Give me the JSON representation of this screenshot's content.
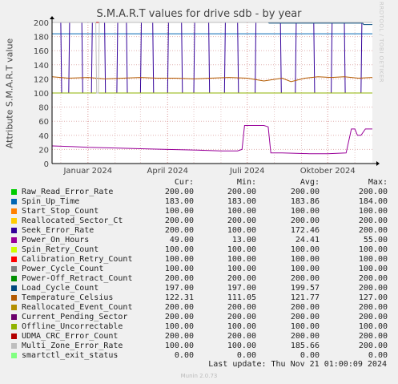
{
  "title": "S.M.A.R.T values for drive sdb - by year",
  "watermark": "RRDTOOL / TOBI OETIKER",
  "last_update": "Last update: Thu Nov 21 01:00:09 2024",
  "footer": "Munin 2.0.73",
  "legend_headers": {
    "cur": "Cur:",
    "min": "Min:",
    "avg": "Avg:",
    "max": "Max:"
  },
  "legend": [
    {
      "name": "Raw_Read_Error_Rate",
      "color": "#00cc00",
      "cur": "200.00",
      "min": "200.00",
      "avg": "200.00",
      "max": "200.00"
    },
    {
      "name": "Spin_Up_Time",
      "color": "#0066b3",
      "cur": "183.00",
      "min": "183.00",
      "avg": "183.86",
      "max": "184.00"
    },
    {
      "name": "Start_Stop_Count",
      "color": "#ff8000",
      "cur": "100.00",
      "min": "100.00",
      "avg": "100.00",
      "max": "100.00"
    },
    {
      "name": "Reallocated_Sector_Ct",
      "color": "#ffcc00",
      "cur": "200.00",
      "min": "200.00",
      "avg": "200.00",
      "max": "200.00"
    },
    {
      "name": "Seek_Error_Rate",
      "color": "#330099",
      "cur": "200.00",
      "min": "100.00",
      "avg": "172.46",
      "max": "200.00"
    },
    {
      "name": "Power_On_Hours",
      "color": "#990099",
      "cur": "49.00",
      "min": "13.00",
      "avg": "24.41",
      "max": "55.00"
    },
    {
      "name": "Spin_Retry_Count",
      "color": "#ccff00",
      "cur": "100.00",
      "min": "100.00",
      "avg": "100.00",
      "max": "100.00"
    },
    {
      "name": "Calibration_Retry_Count",
      "color": "#ff0000",
      "cur": "100.00",
      "min": "100.00",
      "avg": "100.00",
      "max": "100.00"
    },
    {
      "name": "Power_Cycle_Count",
      "color": "#808080",
      "cur": "100.00",
      "min": "100.00",
      "avg": "100.00",
      "max": "100.00"
    },
    {
      "name": "Power-Off_Retract_Count",
      "color": "#008f00",
      "cur": "200.00",
      "min": "200.00",
      "avg": "200.00",
      "max": "200.00"
    },
    {
      "name": "Load_Cycle_Count",
      "color": "#00487d",
      "cur": "197.00",
      "min": "197.00",
      "avg": "199.57",
      "max": "200.00"
    },
    {
      "name": "Temperature_Celsius",
      "color": "#b35a00",
      "cur": "122.31",
      "min": "111.05",
      "avg": "121.77",
      "max": "127.00"
    },
    {
      "name": "Reallocated_Event_Count",
      "color": "#b38f00",
      "cur": "200.00",
      "min": "200.00",
      "avg": "200.00",
      "max": "200.00"
    },
    {
      "name": "Current_Pending_Sector",
      "color": "#6b006b",
      "cur": "200.00",
      "min": "200.00",
      "avg": "200.00",
      "max": "200.00"
    },
    {
      "name": "Offline_Uncorrectable",
      "color": "#8fb300",
      "cur": "100.00",
      "min": "100.00",
      "avg": "100.00",
      "max": "100.00"
    },
    {
      "name": "UDMA_CRC_Error_Count",
      "color": "#b30000",
      "cur": "200.00",
      "min": "200.00",
      "avg": "200.00",
      "max": "200.00"
    },
    {
      "name": "Multi_Zone_Error_Rate",
      "color": "#bebebe",
      "cur": "100.00",
      "min": "100.00",
      "avg": "185.66",
      "max": "200.00"
    },
    {
      "name": "smartctl_exit_status",
      "color": "#80ff80",
      "cur": "0.00",
      "min": "0.00",
      "avg": "0.00",
      "max": "0.00"
    }
  ],
  "chart_data": {
    "type": "line",
    "title": "S.M.A.R.T values for drive sdb - by year",
    "ylabel": "Attribute S.M.A.R.T value",
    "xlabel": "",
    "xlim": [
      "2023-11-21",
      "2024-11-21"
    ],
    "ylim": [
      0,
      200
    ],
    "yticks": [
      0,
      20,
      40,
      60,
      80,
      100,
      120,
      140,
      160,
      180,
      200
    ],
    "xticks": [
      {
        "label": "Januar 2024",
        "date": "2024-01-01"
      },
      {
        "label": "April 2024",
        "date": "2024-04-01"
      },
      {
        "label": "Juli 2024",
        "date": "2024-07-01"
      },
      {
        "label": "Oktober 2024",
        "date": "2024-10-01"
      }
    ],
    "grid": true,
    "series": [
      {
        "name": "Raw_Read_Error_Rate",
        "x": [
          "2023-11-21",
          "2024-11-21"
        ],
        "y": [
          200,
          200
        ]
      },
      {
        "name": "Spin_Up_Time",
        "x": [
          "2023-11-21",
          "2024-11-21"
        ],
        "y": [
          184,
          184
        ]
      },
      {
        "name": "Start_Stop_Count",
        "x": [
          "2023-11-21",
          "2024-11-21"
        ],
        "y": [
          100,
          100
        ]
      },
      {
        "name": "Reallocated_Sector_Ct",
        "x": [
          "2023-11-21",
          "2024-11-21"
        ],
        "y": [
          200,
          200
        ]
      },
      {
        "name": "Seek_Error_Rate",
        "x": [
          "2023-11-21",
          "2023-12-01",
          "2023-12-02",
          "2023-12-10",
          "2023-12-11",
          "2023-12-25",
          "2023-12-26",
          "2024-01-05",
          "2024-01-06",
          "2024-01-20",
          "2024-01-21",
          "2024-02-03",
          "2024-02-04",
          "2024-02-14",
          "2024-02-15",
          "2024-03-01",
          "2024-03-02",
          "2024-03-15",
          "2024-03-16",
          "2024-04-01",
          "2024-04-02",
          "2024-04-17",
          "2024-04-18",
          "2024-05-01",
          "2024-05-02",
          "2024-05-18",
          "2024-05-19",
          "2024-06-05",
          "2024-06-06",
          "2024-06-20",
          "2024-06-21",
          "2024-07-10",
          "2024-07-11",
          "2024-08-08",
          "2024-08-09",
          "2024-08-25",
          "2024-08-26",
          "2024-09-15",
          "2024-09-16",
          "2024-10-05",
          "2024-10-06",
          "2024-10-20",
          "2024-10-21",
          "2024-11-08",
          "2024-11-09",
          "2024-11-21"
        ],
        "y": [
          200,
          200,
          100,
          100,
          200,
          200,
          100,
          100,
          200,
          200,
          100,
          100,
          200,
          200,
          100,
          100,
          200,
          200,
          100,
          100,
          200,
          200,
          100,
          100,
          200,
          200,
          100,
          100,
          200,
          200,
          100,
          100,
          200,
          200,
          100,
          100,
          200,
          200,
          100,
          100,
          200,
          200,
          100,
          100,
          200,
          200
        ]
      },
      {
        "name": "Power_On_Hours",
        "x": [
          "2023-11-21",
          "2023-12-15",
          "2024-01-01",
          "2024-02-01",
          "2024-03-01",
          "2024-04-01",
          "2024-05-05",
          "2024-06-01",
          "2024-06-20",
          "2024-06-25",
          "2024-06-28",
          "2024-07-01",
          "2024-07-20",
          "2024-07-25",
          "2024-07-28",
          "2024-08-10",
          "2024-09-10",
          "2024-10-01",
          "2024-10-22",
          "2024-10-28",
          "2024-11-01",
          "2024-11-04",
          "2024-11-08",
          "2024-11-13",
          "2024-11-21"
        ],
        "y": [
          25,
          24,
          23,
          22,
          21,
          20,
          19,
          18,
          18,
          20,
          54,
          54,
          54,
          52,
          15,
          15,
          14,
          14,
          15,
          49,
          49,
          40,
          40,
          49,
          49
        ]
      },
      {
        "name": "Spin_Retry_Count",
        "x": [
          "2023-11-21",
          "2024-11-21"
        ],
        "y": [
          100,
          100
        ]
      },
      {
        "name": "Calibration_Retry_Count",
        "x": [
          "2023-11-21",
          "2024-11-21"
        ],
        "y": [
          100,
          100
        ]
      },
      {
        "name": "Power_Cycle_Count",
        "x": [
          "2023-11-21",
          "2024-11-21"
        ],
        "y": [
          100,
          100
        ]
      },
      {
        "name": "Power-Off_Retract_Count",
        "x": [
          "2023-11-21",
          "2024-11-21"
        ],
        "y": [
          200,
          200
        ]
      },
      {
        "name": "Load_Cycle_Count",
        "x": [
          "2023-11-21",
          "2024-07-25",
          "2024-07-26",
          "2024-11-10",
          "2024-11-11",
          "2024-11-21"
        ],
        "y": [
          200,
          200,
          199,
          199,
          197,
          197
        ]
      },
      {
        "name": "Temperature_Celsius",
        "x": [
          "2023-11-21",
          "2023-12-10",
          "2024-01-01",
          "2024-01-20",
          "2024-02-10",
          "2024-03-01",
          "2024-03-20",
          "2024-04-10",
          "2024-05-01",
          "2024-05-20",
          "2024-06-10",
          "2024-07-01",
          "2024-07-20",
          "2024-08-10",
          "2024-08-20",
          "2024-09-05",
          "2024-09-20",
          "2024-10-05",
          "2024-10-20",
          "2024-11-05",
          "2024-11-21"
        ],
        "y": [
          123,
          121,
          122,
          120,
          121,
          122,
          121,
          121,
          120,
          121,
          122,
          121,
          117,
          121,
          116,
          121,
          123,
          122,
          123,
          121,
          122
        ]
      },
      {
        "name": "Reallocated_Event_Count",
        "x": [
          "2023-11-21",
          "2024-11-21"
        ],
        "y": [
          200,
          200
        ]
      },
      {
        "name": "Current_Pending_Sector",
        "x": [
          "2023-11-21",
          "2024-11-21"
        ],
        "y": [
          200,
          200
        ]
      },
      {
        "name": "Offline_Uncorrectable",
        "x": [
          "2023-11-21",
          "2024-11-21"
        ],
        "y": [
          100,
          100
        ]
      },
      {
        "name": "UDMA_CRC_Error_Count",
        "x": [
          "2023-11-21",
          "2024-11-21"
        ],
        "y": [
          200,
          200
        ]
      },
      {
        "name": "Multi_Zone_Error_Rate",
        "x": [
          "2023-11-21",
          "2024-01-10",
          "2024-01-11",
          "2024-01-13",
          "2024-01-14",
          "2024-11-21"
        ],
        "y": [
          200,
          200,
          100,
          100,
          200,
          200
        ]
      },
      {
        "name": "smartctl_exit_status",
        "x": [
          "2023-11-21",
          "2024-11-21"
        ],
        "y": [
          0,
          0
        ]
      }
    ]
  }
}
